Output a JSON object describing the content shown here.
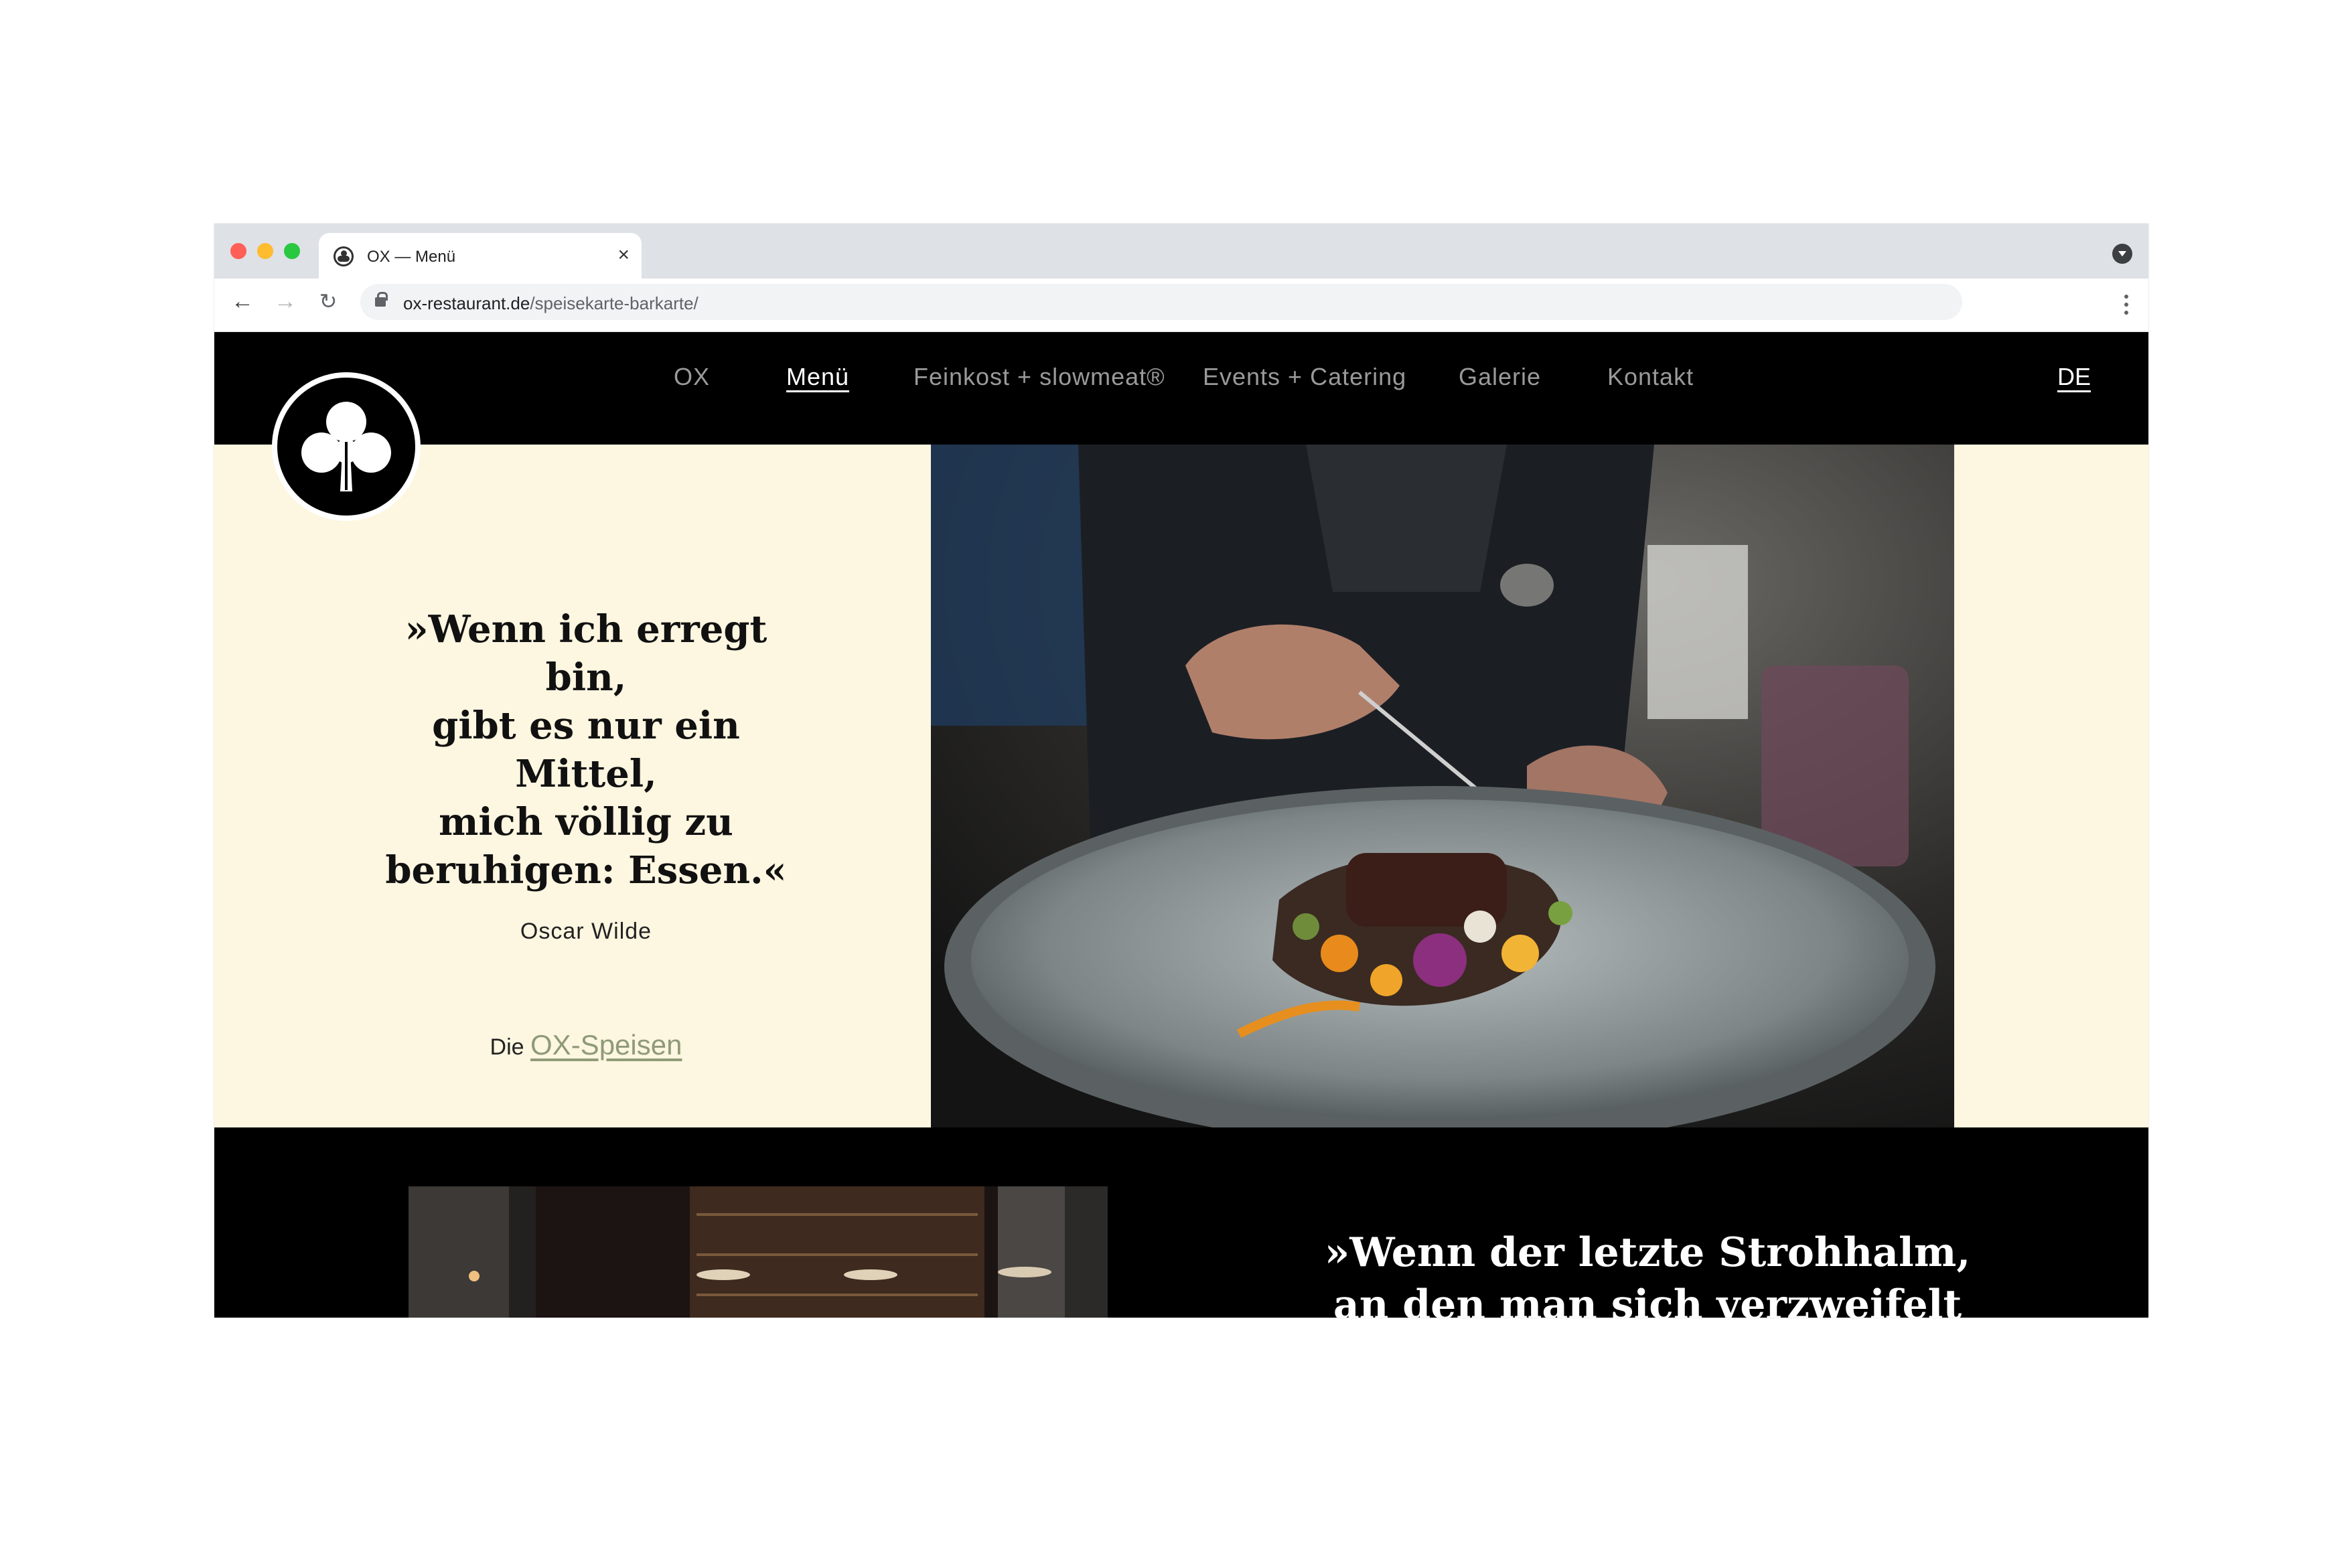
{
  "browser": {
    "tab_title": "OX — Menü",
    "tab_close": "×",
    "url_host": "ox-restaurant.de",
    "url_path": "/speisekarte-barkarte/",
    "back_icon": "←",
    "forward_icon": "→",
    "reload_icon": "↻"
  },
  "site": {
    "nav": [
      "OX",
      "Menü",
      "Feinkost + slowmeat®",
      "Events + Catering",
      "Galerie",
      "Kontakt"
    ],
    "active_nav": "Menü",
    "language": "DE",
    "logo_icon": "club-icon"
  },
  "hero": {
    "quote": "»Wenn ich erregt bin, gibt es nur ein Mittel, mich völlig zu beruhigen: Essen.«",
    "quote_lines": [
      "»Wenn ich erregt bin,",
      "gibt es nur ein Mittel,",
      "mich völlig zu",
      "beruhigen: Essen.«"
    ],
    "author": "Oscar Wilde",
    "link_prefix": "Die",
    "link_text": "OX-Speisen"
  },
  "second_section": {
    "quote_lines": [
      "»Wenn der letzte Strohhalm,",
      "an den man sich verzweifelt"
    ]
  },
  "colors": {
    "cream": "#fdf6e0",
    "link_green": "#8f9a78",
    "black": "#000000"
  }
}
